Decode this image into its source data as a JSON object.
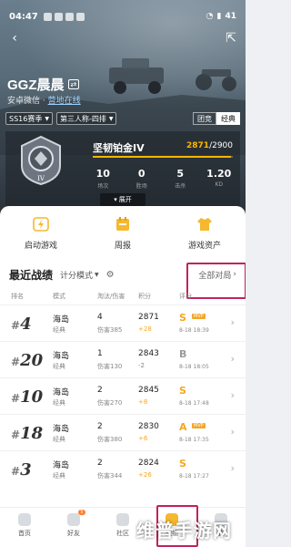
{
  "status": {
    "time": "04:47",
    "battery": "41"
  },
  "profile": {
    "nickname": "GGZ晨晨",
    "badge": "⇄",
    "subtitle_prefix": "安卓微信 ·",
    "subtitle_link": "营地在线"
  },
  "filters": {
    "season": "SS16赛季",
    "mode": "第三人称-四排",
    "mode_buttons": [
      "团竞",
      "经典"
    ],
    "active_mode": "经典"
  },
  "rank": {
    "name": "坚韧铂金IV",
    "score_current": "2871",
    "score_max": "/2900",
    "progress": 0.99
  },
  "stats": [
    {
      "value": "10",
      "label": "场次"
    },
    {
      "value": "0",
      "label": "胜场"
    },
    {
      "value": "5",
      "label": "击杀"
    },
    {
      "value": "1.20",
      "label": "KD"
    }
  ],
  "expand_label": "展开",
  "quick_actions": [
    {
      "label": "启动游戏",
      "icon": "lightning-icon"
    },
    {
      "label": "周报",
      "icon": "calendar-icon"
    },
    {
      "label": "游戏资产",
      "icon": "shirt-icon"
    }
  ],
  "recent": {
    "title": "最近战绩",
    "mode": "计分模式",
    "all_records": "全部对局"
  },
  "table_headers": [
    "排名",
    "模式",
    "淘汰/伤害",
    "积分",
    "评分"
  ],
  "matches": [
    {
      "rank": "4",
      "map": "海岛",
      "mode": "经典",
      "kills": "4",
      "damage": "伤害385",
      "points": "2871",
      "delta": "+28",
      "delta_color": "#f5a623",
      "grade": "S",
      "grade_tag": "MVP",
      "grade_color": "#f5a623",
      "date": "8-18 18:39"
    },
    {
      "rank": "20",
      "map": "海岛",
      "mode": "经典",
      "kills": "1",
      "damage": "伤害130",
      "points": "2843",
      "delta": "-2",
      "delta_color": "#888888",
      "grade": "B",
      "grade_tag": "",
      "grade_color": "#999999",
      "date": "8-18 18:05"
    },
    {
      "rank": "10",
      "map": "海岛",
      "mode": "经典",
      "kills": "2",
      "damage": "伤害270",
      "points": "2845",
      "delta": "+8",
      "delta_color": "#f5a623",
      "grade": "S",
      "grade_tag": "",
      "grade_color": "#f5a623",
      "date": "8-18 17:48"
    },
    {
      "rank": "18",
      "map": "海岛",
      "mode": "经典",
      "kills": "2",
      "damage": "伤害380",
      "points": "2830",
      "delta": "+6",
      "delta_color": "#f5a623",
      "grade": "A",
      "grade_tag": "MVP",
      "grade_color": "#f5a623",
      "date": "8-18 17:35"
    },
    {
      "rank": "3",
      "map": "海岛",
      "mode": "经典",
      "kills": "2",
      "damage": "伤害344",
      "points": "2824",
      "delta": "+26",
      "delta_color": "#f5a623",
      "grade": "S",
      "grade_tag": "",
      "grade_color": "#f5a623",
      "date": "8-18 17:27"
    }
  ],
  "nav": [
    {
      "label": "首页",
      "badge": ""
    },
    {
      "label": "好友",
      "badge": "5"
    },
    {
      "label": "社区",
      "badge": ""
    },
    {
      "label": "战绩",
      "badge": ""
    },
    {
      "label": "我",
      "badge": ""
    }
  ],
  "nav_active": 3,
  "watermark": "维普手游网"
}
